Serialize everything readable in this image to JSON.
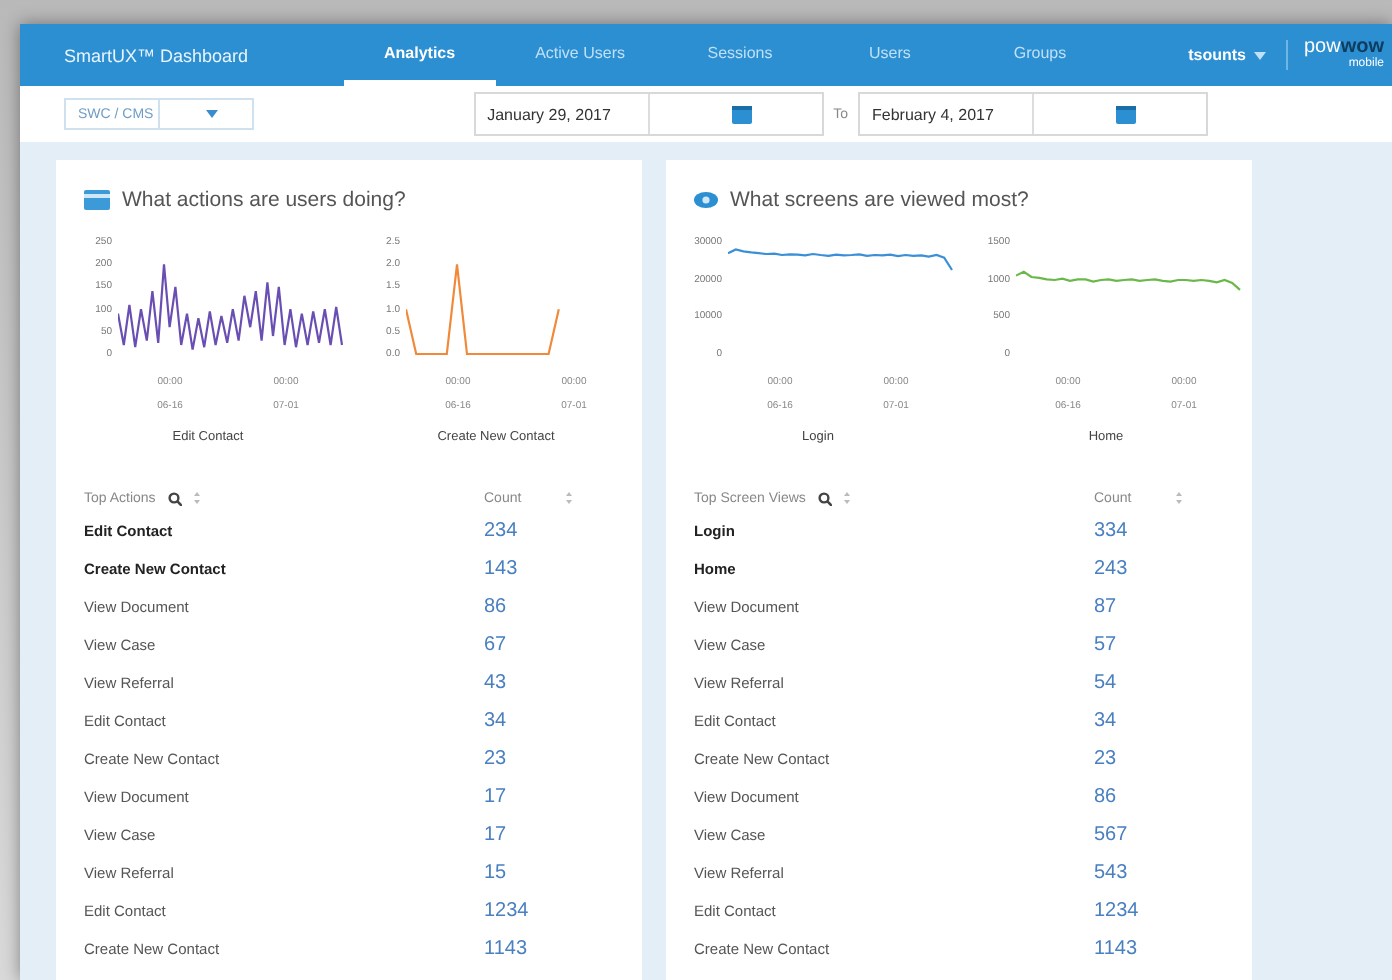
{
  "app_bar": {
    "title": "SmartUX™ Dashboard",
    "tabs": [
      {
        "label": "Analytics",
        "selected": true
      },
      {
        "label": "Active Users",
        "selected": false
      },
      {
        "label": "Sessions",
        "selected": false
      },
      {
        "label": "Users",
        "selected": false
      },
      {
        "label": "Groups",
        "selected": false
      }
    ],
    "user": "tsounts",
    "logo": {
      "first": "pow",
      "second": "wow",
      "sub": "mobile"
    }
  },
  "filter_bar": {
    "app_select": "SWC / CMS",
    "date_from": "January 29, 2017",
    "to_label": "To",
    "date_to": "February 4, 2017"
  },
  "panels": [
    {
      "title": "What actions are users doing?",
      "charts": [
        {
          "label": "Edit Contact",
          "xticks": [
            {
              "time": "00:00",
              "date": "06-16"
            },
            {
              "time": "00:00",
              "date": "07-01"
            }
          ],
          "chart_data": {
            "type": "line",
            "ylim": [
              0,
              250
            ],
            "yticks": [
              250,
              200,
              150,
              100,
              50,
              0
            ],
            "series": [
              {
                "color": "#6a4fb3",
                "values": [
                  90,
                  20,
                  110,
                  15,
                  100,
                  30,
                  140,
                  25,
                  200,
                  60,
                  150,
                  20,
                  90,
                  10,
                  80,
                  15,
                  95,
                  20,
                  85,
                  25,
                  100,
                  30,
                  130,
                  60,
                  140,
                  30,
                  160,
                  40,
                  150,
                  20,
                  100,
                  15,
                  90,
                  20,
                  95,
                  25,
                  100,
                  20,
                  105,
                  20
                ]
              }
            ]
          }
        },
        {
          "label": "Create New Contact",
          "xticks": [
            {
              "time": "00:00",
              "date": "06-16"
            },
            {
              "time": "00:00",
              "date": "07-01"
            }
          ],
          "chart_data": {
            "type": "line",
            "ylim": [
              0,
              2.5
            ],
            "yticks": [
              {
                "value": 2.5,
                "label": "2.5"
              },
              {
                "value": 2,
                "label": "2.0"
              },
              {
                "value": 1.5,
                "label": "1.5"
              },
              {
                "value": 1,
                "label": "1.0"
              },
              {
                "value": 0.5,
                "label": "0.5"
              },
              {
                "value": 0,
                "label": "0.0"
              }
            ],
            "series": [
              {
                "color": "#f08a3a",
                "values": [
                  1,
                  0,
                  0,
                  0,
                  0,
                  2,
                  0,
                  0,
                  0,
                  0,
                  0,
                  0,
                  0,
                  0,
                  0,
                  1,
                  null,
                  null,
                  null,
                  null,
                  null,
                  null,
                  null
                ]
              }
            ]
          }
        }
      ],
      "table": {
        "columns": [
          "Top Actions",
          "Count"
        ],
        "rows": [
          {
            "name": "Edit Contact",
            "count": "234",
            "emphasized": true
          },
          {
            "name": "Create New Contact",
            "count": "143",
            "emphasized": true
          },
          {
            "name": "View Document",
            "count": "86",
            "emphasized": false
          },
          {
            "name": "View Case",
            "count": "67",
            "emphasized": false
          },
          {
            "name": "View Referral",
            "count": "43",
            "emphasized": false
          },
          {
            "name": "Edit Contact",
            "count": "34",
            "emphasized": false
          },
          {
            "name": "Create New Contact",
            "count": "23",
            "emphasized": false
          },
          {
            "name": "View Document",
            "count": "17",
            "emphasized": false
          },
          {
            "name": "View Case",
            "count": "17",
            "emphasized": false
          },
          {
            "name": "View Referral",
            "count": "15",
            "emphasized": false
          },
          {
            "name": "Edit Contact",
            "count": "1234",
            "emphasized": false
          },
          {
            "name": "Create New Contact",
            "count": "1143",
            "emphasized": false
          }
        ]
      }
    },
    {
      "title": "What screens are viewed most?",
      "charts": [
        {
          "label": "Login",
          "xticks": [
            {
              "time": "00:00",
              "date": "06-16"
            },
            {
              "time": "00:00",
              "date": "07-01"
            }
          ],
          "chart_data": {
            "type": "line",
            "ylim": [
              0,
              30000
            ],
            "yticks": [
              30000,
              20000,
              10000,
              0
            ],
            "series": [
              {
                "color": "#3a8fd6",
                "values": [
                  27000,
                  28000,
                  27500,
                  27200,
                  27000,
                  26800,
                  26900,
                  26500,
                  26700,
                  26600,
                  26400,
                  26800,
                  26500,
                  26300,
                  26600,
                  26400,
                  26500,
                  26700,
                  26300,
                  26500,
                  26400,
                  26600,
                  26200,
                  26500,
                  26300,
                  26400,
                  26100,
                  26500,
                  25800,
                  22500
                ]
              }
            ]
          }
        },
        {
          "label": "Home",
          "xticks": [
            {
              "time": "00:00",
              "date": "06-16"
            },
            {
              "time": "00:00",
              "date": "07-01"
            }
          ],
          "chart_data": {
            "type": "line",
            "ylim": [
              0,
              1500
            ],
            "yticks": [
              1500,
              1000,
              500,
              0
            ],
            "series": [
              {
                "color": "#6bb84a",
                "values": [
                  1050,
                  1100,
                  1030,
                  1020,
                  1000,
                  990,
                  1010,
                  980,
                  1000,
                  1000,
                  970,
                  990,
                  1000,
                  980,
                  990,
                  1000,
                  980,
                  990,
                  1000,
                  980,
                  970,
                  990,
                  990,
                  980,
                  990,
                  980,
                  960,
                  990,
                  950,
                  860
                ]
              }
            ]
          }
        }
      ],
      "table": {
        "columns": [
          "Top Screen Views",
          "Count"
        ],
        "rows": [
          {
            "name": "Login",
            "count": "334",
            "emphasized": true
          },
          {
            "name": "Home",
            "count": "243",
            "emphasized": true
          },
          {
            "name": "View Document",
            "count": "87",
            "emphasized": false
          },
          {
            "name": "View Case",
            "count": "57",
            "emphasized": false
          },
          {
            "name": "View Referral",
            "count": "54",
            "emphasized": false
          },
          {
            "name": "Edit Contact",
            "count": "34",
            "emphasized": false
          },
          {
            "name": "Create New Contact",
            "count": "23",
            "emphasized": false
          },
          {
            "name": "View Document",
            "count": "86",
            "emphasized": false
          },
          {
            "name": "View Case",
            "count": "567",
            "emphasized": false
          },
          {
            "name": "View Referral",
            "count": "543",
            "emphasized": false
          },
          {
            "name": "Edit Contact",
            "count": "1234",
            "emphasized": false
          },
          {
            "name": "Create New Contact",
            "count": "1143",
            "emphasized": false
          }
        ]
      }
    }
  ]
}
